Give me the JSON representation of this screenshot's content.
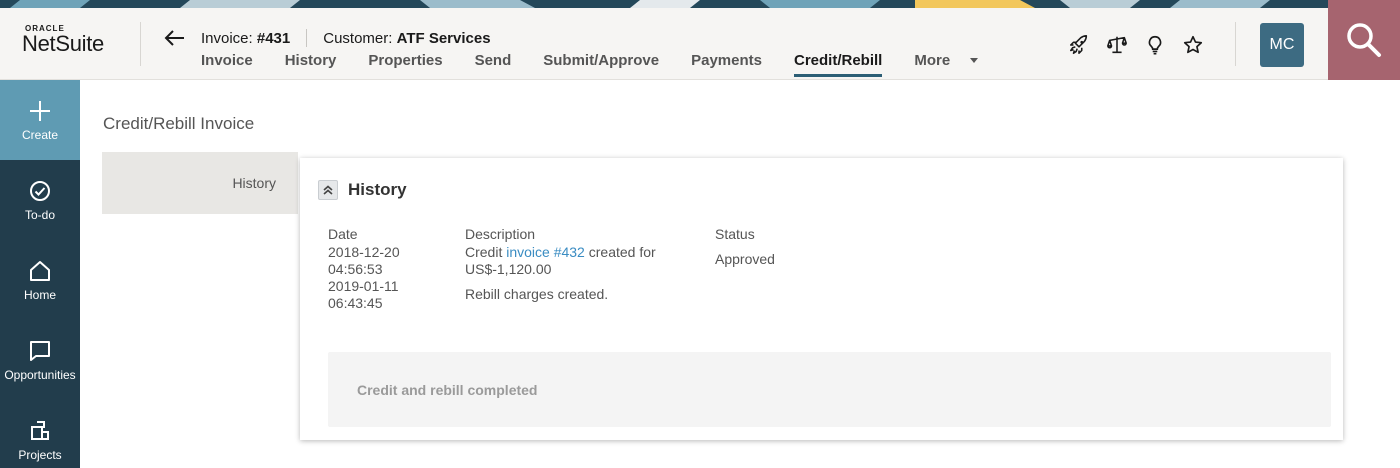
{
  "brand": {
    "oracle": "ORACLE",
    "product": "NetSuite",
    "colors": {
      "nav_bg": "#223d4c",
      "create_bg": "#5f9bb3",
      "search_bg": "#a6646f",
      "avatar_bg": "#3d6b82",
      "tab_underline": "#2c5e75",
      "link": "#3a8cc2"
    }
  },
  "record": {
    "type_label": "Invoice:",
    "number": "#431",
    "customer_label": "Customer:",
    "customer_name": "ATF Services"
  },
  "tabs": [
    {
      "label": "Invoice"
    },
    {
      "label": "History"
    },
    {
      "label": "Properties"
    },
    {
      "label": "Send"
    },
    {
      "label": "Submit/Approve"
    },
    {
      "label": "Payments"
    },
    {
      "label": "Credit/Rebill",
      "active": true
    },
    {
      "label": "More"
    }
  ],
  "header_icons": [
    "rocket-icon",
    "scales-icon",
    "lightbulb-icon",
    "star-icon"
  ],
  "user": {
    "initials": "MC"
  },
  "nav": [
    {
      "label": "Create",
      "icon": "plus-icon"
    },
    {
      "label": "To-do",
      "icon": "check-circle-icon"
    },
    {
      "label": "Home",
      "icon": "home-icon"
    },
    {
      "label": "Opportunities",
      "icon": "chat-bubble-icon"
    },
    {
      "label": "Projects",
      "icon": "projects-icon"
    }
  ],
  "page": {
    "title": "Credit/Rebill Invoice",
    "side_tab": "History"
  },
  "history": {
    "title": "History",
    "columns": {
      "date": "Date",
      "description": "Description",
      "status": "Status"
    },
    "row": {
      "date1": "2018-12-20",
      "time1": "04:56:53",
      "date2": "2019-01-11",
      "time2": "06:43:45",
      "desc_prefix": "Credit ",
      "desc_link": "invoice #432",
      "desc_suffix": " created for",
      "desc_amount": "US$-1,120.00",
      "desc_rebill": "Rebill charges created.",
      "status": "Approved"
    },
    "completed_message": "Credit and rebill completed"
  }
}
